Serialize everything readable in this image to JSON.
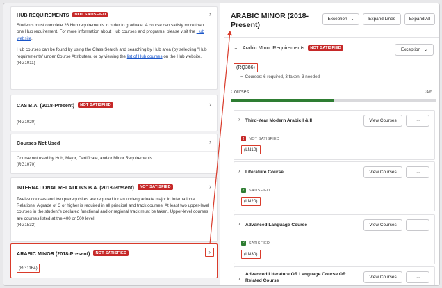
{
  "left": {
    "hub": {
      "title": "HUB REQUIREMENTS",
      "badge": "NOT SATISFIED",
      "p1_pre": "Students must complete 26 Hub requirements in order to graduate. A course can satisfy more than one Hub requirement. For more information about Hub courses and programs, please visit the ",
      "p1_link": "Hub website",
      "p1_post": ".",
      "p2_pre": "Hub courses can be found by using the Class Search and searching by Hub area (by selecting \"Hub requirements\" under Course Attributes), or by viewing the ",
      "p2_link": "list of Hub courses",
      "p2_post": " on the Hub website.",
      "code": "(RG1011)"
    },
    "cas": {
      "title": "CAS B.A. (2018-Present)",
      "badge": "NOT SATISFIED",
      "code": "(RG1020)"
    },
    "notused": {
      "title": "Courses Not Used",
      "desc": "Course not used by Hub, Major, Certificate, and/or Minor Requirements",
      "code": "(RG1070)"
    },
    "ir": {
      "title": "INTERNATIONAL RELATIONS B.A. (2018-Present)",
      "badge": "NOT SATISFIED",
      "desc": "Twelve courses and two prerequisites are required for an undergraduate major in International Relations. A grade of C or higher is required in all principal and track courses. At least two upper-level courses in the student's declared functional and or regional track must be taken. Upper-level courses are courses listed at the 400 or 500 level.",
      "code": "(RG1532)"
    },
    "arabic": {
      "title": "ARABIC MINOR (2018-Present)",
      "badge": "NOT SATISFIED",
      "code": "(RG1164)"
    }
  },
  "right": {
    "title": "ARABIC MINOR (2018-Present)",
    "buttons": {
      "exception": "Exception",
      "expand_lines": "Expand Lines",
      "expand_all": "Expand All"
    },
    "req": {
      "title": "Arabic Minor Requirements",
      "badge": "NOT SATISFIED",
      "exception": "Exception",
      "code": "(RQ386)",
      "summary": "Courses: 6 required, 3 taken, 3 needed"
    },
    "courses_label": "Courses",
    "progress_text": "3/6",
    "progress_fraction": 0.5,
    "view_courses": "View Courses",
    "more": "···",
    "lines": [
      {
        "title": "Third-Year Modern Arabic I & II",
        "status": "NOT SATISFIED",
        "code": "(LN10)"
      },
      {
        "title": "Literature Course",
        "status": "SATISFIED",
        "code": "(LN20)"
      },
      {
        "title": "Advanced Language Course",
        "status": "SATISFIED",
        "code": "(LN30)"
      },
      {
        "title": "Advanced Literature OR Language Course OR Related Course"
      }
    ]
  },
  "colors": {
    "not_satisfied": "#c62828",
    "satisfied": "#2e7d32",
    "highlight": "#d93b2b",
    "link": "#1a56c9"
  }
}
